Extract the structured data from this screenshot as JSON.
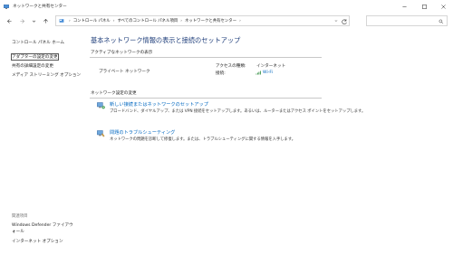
{
  "window": {
    "title": "ネットワークと共有センター",
    "minimize_icon": "minimize-icon",
    "maximize_icon": "maximize-icon",
    "close_icon": "close-icon"
  },
  "navigation": {
    "breadcrumb": [
      "コントロール パネル",
      "すべてのコントロール パネル項目",
      "ネットワークと共有センター"
    ],
    "search_placeholder": ""
  },
  "sidebar": {
    "links": [
      "コントロール パネル ホーム",
      "アダプターの設定の変更",
      "共有の詳細設定の変更",
      "メディア ストリーミング オプション"
    ],
    "see_also_header": "関連項目",
    "see_also_links": [
      "Windows Defender ファイアウォール",
      "インターネット オプション"
    ]
  },
  "main": {
    "title": "基本ネットワーク情報の表示と接続のセットアップ",
    "active_networks_header": "アクティブなネットワークの表示",
    "network_name": "プライベート ネットワーク",
    "access_type_label": "アクセスの種類:",
    "access_type_value": "インターネット",
    "connections_label": "接続:",
    "connection_value": "Wi-Fi",
    "change_settings_header": "ネットワーク設定の変更",
    "tasks": [
      {
        "link": "新しい接続またはネットワークのセットアップ",
        "description": "ブロードバンド、ダイヤルアップ、または VPN 接続をセットアップします。あるいは、ルーターまたはアクセス ポイントをセットアップします。",
        "icon": "new-connection-icon"
      },
      {
        "link": "問題のトラブルシューティング",
        "description": "ネットワークの問題を診断して修復します。または、トラブルシューティングに関する情報を入手します。",
        "icon": "troubleshoot-icon"
      }
    ]
  },
  "colors": {
    "title_blue": "#1e3d7a",
    "link_blue": "#0067c0",
    "border": "#d6d6d6"
  }
}
